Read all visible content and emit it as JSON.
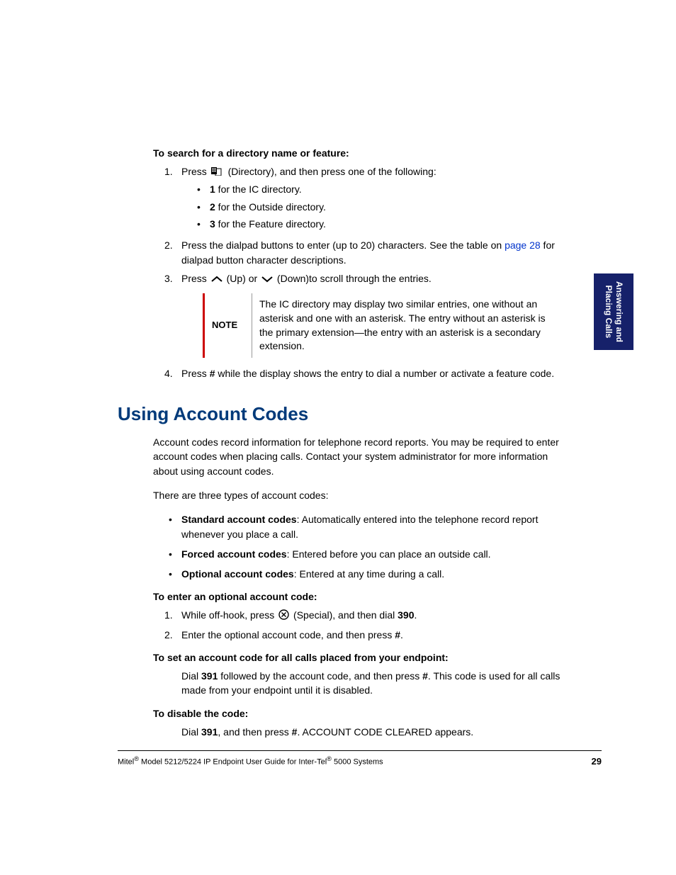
{
  "header1": "To search for a directory name or feature:",
  "step1": {
    "pre": "Press ",
    "mid": " (Directory), and then press one of the following:",
    "b1_bold": "1",
    "b1_rest": " for the IC directory.",
    "b2_bold": "2",
    "b2_rest": " for the Outside directory.",
    "b3_bold": "3",
    "b3_rest": " for the Feature directory."
  },
  "step2": {
    "pre": "Press the dialpad buttons to enter (up to 20) characters. See the table on ",
    "link": "page 28",
    "post": " for dialpad button character descriptions."
  },
  "step3": {
    "pre": "Press ",
    "mid1": " (Up) or ",
    "mid2": " (Down)to scroll through the entries."
  },
  "note": {
    "label": "NOTE",
    "text": "The IC directory may display two similar entries, one without an asterisk and one with an asterisk. The entry without an asterisk is the primary extension—the entry with an asterisk is a secondary extension."
  },
  "step4": {
    "pre": "Press ",
    "hash": "#",
    "post": " while the display shows the entry to dial a number or activate a feature code."
  },
  "section_title": "Using Account Codes",
  "para1": "Account codes record information for telephone record reports. You may be required to enter account codes when placing calls. Contact your system administrator for more information about using account codes.",
  "para2": "There are three types of account codes:",
  "types": {
    "t1_bold": "Standard account codes",
    "t1_rest": ": Automatically entered into the telephone record report whenever you place a call.",
    "t2_bold": "Forced account codes",
    "t2_rest": ": Entered before you can place an outside call.",
    "t3_bold": "Optional account codes",
    "t3_rest": ": Entered at any time during a call."
  },
  "header2": "To enter an optional account code:",
  "enter": {
    "s1_pre": "While off-hook, press ",
    "s1_mid": " (Special), and then dial ",
    "s1_code": "390",
    "s1_post": ".",
    "s2_pre": "Enter the optional account code, and then press ",
    "s2_hash": "#",
    "s2_post": "."
  },
  "header3": "To set an account code for all calls placed from your endpoint:",
  "set": {
    "pre": "Dial ",
    "code": "391",
    "mid": " followed by the account code, and then press ",
    "hash": "#",
    "post": ". This code is used for all calls made from your endpoint until it is disabled."
  },
  "header4": "To disable the code:",
  "disable": {
    "pre": "Dial ",
    "code": "391",
    "mid": ", and then press ",
    "hash": "#",
    "post": ". ACCOUNT CODE CLEARED appears."
  },
  "sidetab": {
    "line1": "Answering and",
    "line2": "Placing Calls"
  },
  "footer": {
    "pre": "Mitel",
    "mid1": " Model 5212/5224 IP Endpoint User Guide for Inter-Tel",
    "mid2": " 5000 Systems",
    "reg": "®",
    "page": "29"
  }
}
